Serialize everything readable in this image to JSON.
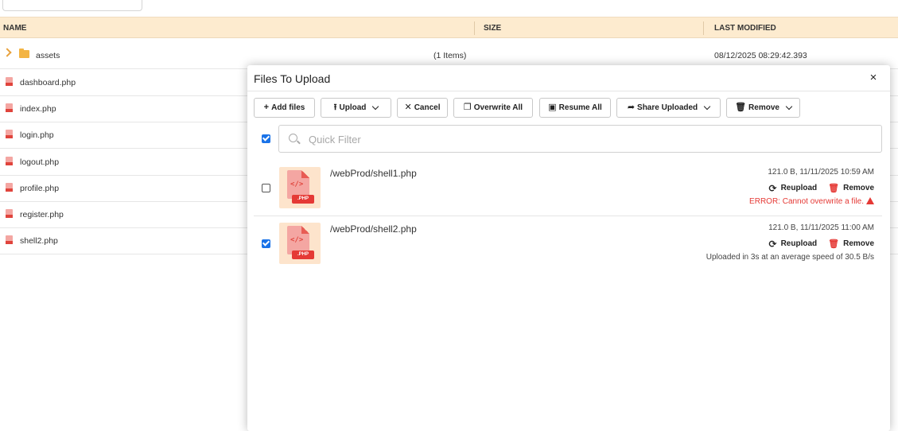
{
  "browser": {
    "columns": {
      "name": "NAME",
      "size": "SIZE",
      "modified": "LAST MODIFIED"
    },
    "folder": {
      "name": "assets",
      "size": "(1 Items)",
      "modified": "08/12/2025 08:29:42.393"
    },
    "files": [
      "dashboard.php",
      "index.php",
      "login.php",
      "logout.php",
      "profile.php",
      "register.php",
      "shell2.php"
    ]
  },
  "dialog": {
    "title": "Files To Upload",
    "close": "×",
    "toolbar": {
      "add_files": "Add files",
      "upload": "Upload",
      "cancel": "Cancel",
      "overwrite_all": "Overwrite All",
      "resume_all": "Resume All",
      "share_uploaded": "Share Uploaded",
      "remove": "Remove"
    },
    "filter": {
      "placeholder": "Quick Filter",
      "value": ""
    },
    "select_all_checked": true,
    "items": [
      {
        "path": "/webProd/shell1.php",
        "meta": "121.0 B, 11/11/2025 10:59 AM",
        "reupload": "Reupload",
        "remove": "Remove",
        "status": "ERROR: Cannot overwrite a file.",
        "status_type": "error",
        "checked": false,
        "thumb_code": "</>",
        "thumb_badge": ".PHP"
      },
      {
        "path": "/webProd/shell2.php",
        "meta": "121.0 B, 11/11/2025 11:00 AM",
        "reupload": "Reupload",
        "remove": "Remove",
        "status": "Uploaded in 3s at an average speed of 30.5 B/s",
        "status_type": "ok",
        "checked": true,
        "thumb_code": "</>",
        "thumb_badge": ".PHP"
      }
    ]
  },
  "colors": {
    "header_bg": "#fdebcf",
    "accent": "#1a73e8",
    "error": "#e53935",
    "folder": "#f3b443"
  },
  "icons": {
    "add": "plus-icon",
    "upload": "upload-icon",
    "cancel": "x-icon",
    "overwrite": "copy-icon",
    "resume": "files-icon",
    "share": "share-arrow-icon",
    "remove": "trash-icon",
    "reupload": "refresh-icon"
  }
}
